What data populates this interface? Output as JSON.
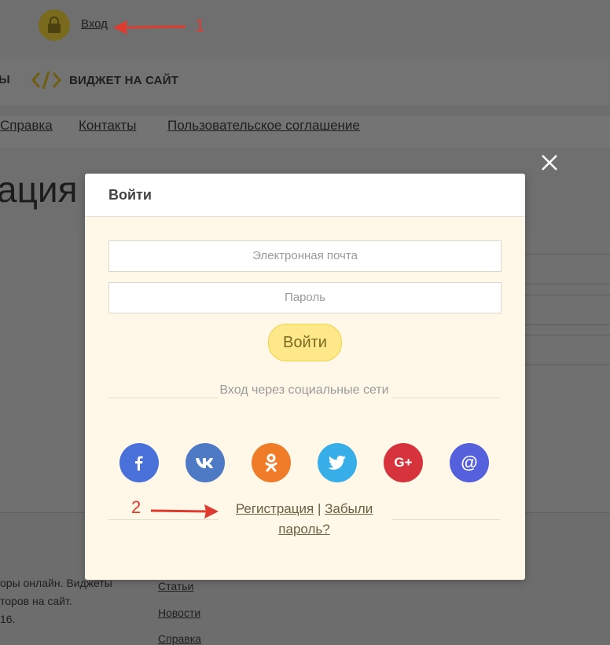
{
  "header": {
    "login_link": "Вход"
  },
  "nav": {
    "cut_item": "Ы",
    "widget_label": "ВИДЖЕТ НА САЙТ"
  },
  "links": [
    "Справка",
    "Контакты",
    "Пользовательское соглашение"
  ],
  "page": {
    "heading_fragment": "ация"
  },
  "footer": {
    "text_lines": [
      "оры онлайн. Виджеты",
      "торов на сайт.",
      "16."
    ],
    "links": [
      "Статьи",
      "Новости",
      "Справка"
    ]
  },
  "annotations": {
    "arrow1_number": "1",
    "arrow2_number": "2"
  },
  "modal": {
    "title": "Войти",
    "email_placeholder": "Электронная почта",
    "password_placeholder": "Пароль",
    "submit_label": "Войти",
    "social_label": "Вход через социальные сети",
    "social_networks": [
      {
        "name": "facebook-icon",
        "glyph": "f",
        "color": "#3b5998"
      },
      {
        "name": "vk-icon",
        "glyph": "vk",
        "color": "#4a76a8"
      },
      {
        "name": "odnoklassniki-icon",
        "glyph": "ok",
        "color": "#ee8208"
      },
      {
        "name": "twitter-icon",
        "glyph": "t",
        "color": "#1da1f2"
      },
      {
        "name": "google-plus-icon",
        "glyph": "G+",
        "color": "#dd4b39"
      },
      {
        "name": "mail-icon",
        "glyph": "@",
        "color": "#4c5fd7"
      }
    ],
    "register_link": "Регистрация",
    "separator": "|",
    "forgot_link": "Забыли пароль?"
  }
}
